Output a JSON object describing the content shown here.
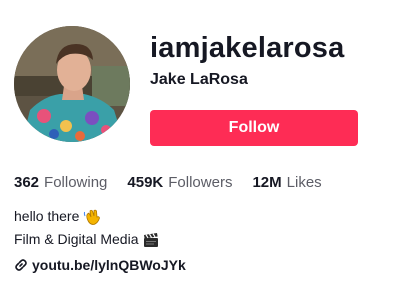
{
  "profile": {
    "username": "iamjakelarosa",
    "display_name": "Jake LaRosa",
    "follow_label": "Follow"
  },
  "stats": {
    "following": {
      "count": "362",
      "label": "Following"
    },
    "followers": {
      "count": "459K",
      "label": "Followers"
    },
    "likes": {
      "count": "12M",
      "label": "Likes"
    }
  },
  "bio": {
    "line1": "hello there",
    "line1_icon": "waving-hand-icon",
    "line2": "Film & Digital Media",
    "line2_icon": "clapper-board-icon"
  },
  "link": {
    "text": "youtu.be/lylnQBWoJYk",
    "icon": "link-icon"
  },
  "colors": {
    "accent": "#fe2c55",
    "text_primary": "#161823",
    "text_secondary": "#5c5d66"
  }
}
